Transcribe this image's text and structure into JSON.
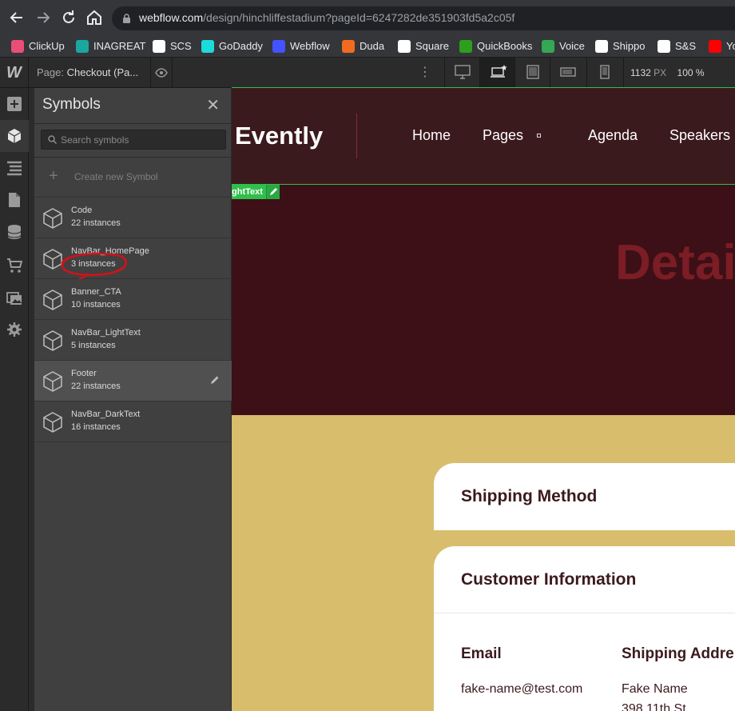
{
  "browser": {
    "url_host": "webflow.com",
    "url_path": "/design/hinchliffestadium?pageId=6247282de351903fd5a2c05f",
    "bookmarks": [
      {
        "label": "ClickUp",
        "color": "#e94e77"
      },
      {
        "label": "INAGREAT",
        "color": "#1aa7a0"
      },
      {
        "label": "SCS",
        "color": "#ffffff"
      },
      {
        "label": "GoDaddy",
        "color": "#1bdbdb"
      },
      {
        "label": "Webflow",
        "color": "#4353ff"
      },
      {
        "label": "Duda",
        "color": "#f26b21"
      },
      {
        "label": "Square",
        "color": "#ffffff"
      },
      {
        "label": "QuickBooks",
        "color": "#2ca01c"
      },
      {
        "label": "Voice",
        "color": "#34a853"
      },
      {
        "label": "Shippo",
        "color": "#ffffff"
      },
      {
        "label": "S&S",
        "color": "#ffffff"
      },
      {
        "label": "Yo",
        "color": "#ff0000"
      }
    ]
  },
  "designer": {
    "logo": "W",
    "page_prefix": "Page:",
    "page_name": "Checkout (Pa...",
    "canvas_width": "1132",
    "canvas_unit": "PX",
    "zoom": "100 %"
  },
  "symbols_panel": {
    "title": "Symbols",
    "search_placeholder": "Search symbols",
    "create_label": "Create new Symbol",
    "items": [
      {
        "name": "Code",
        "instances": "22 instances"
      },
      {
        "name": "NavBar_HomePage",
        "instances": "3 instances"
      },
      {
        "name": "Banner_CTA",
        "instances": "10 instances"
      },
      {
        "name": "NavBar_LightText",
        "instances": "5 instances"
      },
      {
        "name": "Footer",
        "instances": "22 instances"
      },
      {
        "name": "NavBar_DarkText",
        "instances": "16 instances"
      }
    ]
  },
  "canvas": {
    "brand": "Evently",
    "nav": [
      "Home",
      "Pages",
      "Agenda",
      "Speakers"
    ],
    "symbol_tag": "ghtText",
    "hero_title": "Detai",
    "shipping_title": "Shipping Method",
    "customer_title": "Customer Information",
    "email_label": "Email",
    "email_value": "fake-name@test.com",
    "address_label": "Shipping Addre",
    "address_name": "Fake Name",
    "address_street": "398 11th St"
  },
  "colors": {
    "accent_green": "#2fbf4a",
    "site_nav_bg": "#3b1a1e",
    "hero_bg": "#3d0f16",
    "page_bg": "#d8bd6c"
  }
}
